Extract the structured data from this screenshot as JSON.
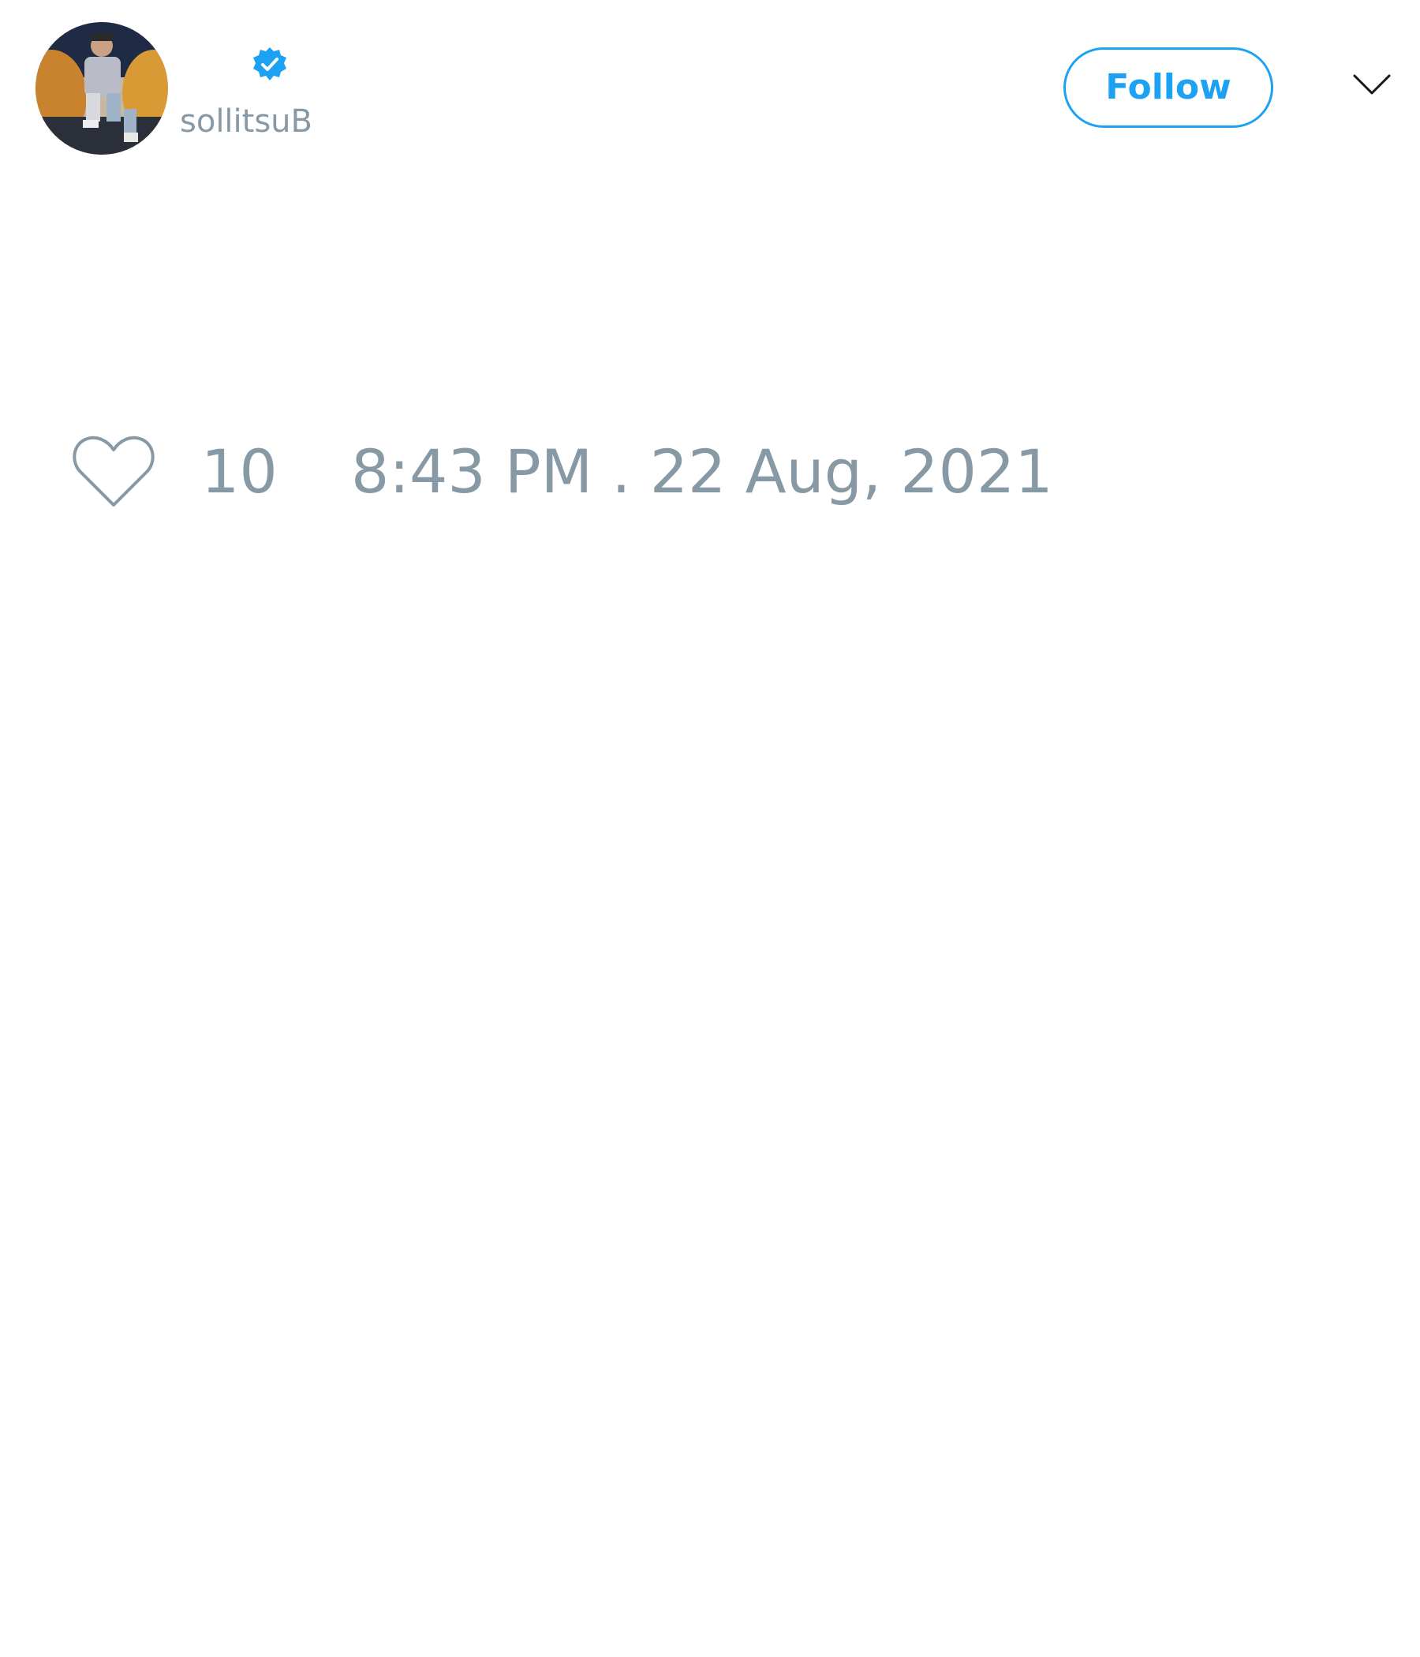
{
  "tweet": {
    "author": {
      "display_name": "",
      "handle": "sollitsuB",
      "verified": true,
      "avatar_icon": "profile-photo"
    },
    "follow_label": "Follow",
    "like_count": "10",
    "timestamp": "8:43 PM . 22 Aug, 2021"
  },
  "colors": {
    "accent": "#1da1f2",
    "muted_text": "#8899a6",
    "background": "#ffffff"
  },
  "icons": {
    "verified": "verified-badge-icon",
    "menu": "chevron-down-icon",
    "like": "heart-icon"
  }
}
